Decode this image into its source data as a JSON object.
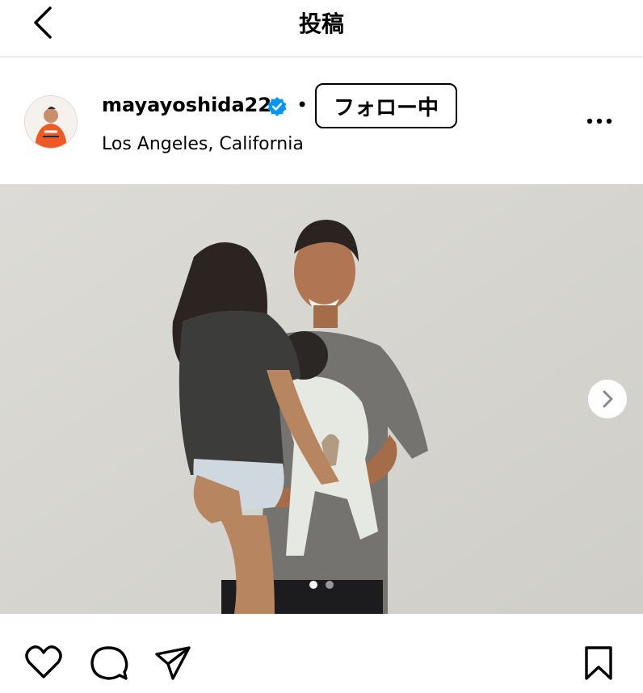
{
  "header": {
    "title": "投稿",
    "back_icon": "chevron-left-icon"
  },
  "post": {
    "username": "mayayoshida22",
    "verified_icon": "verified-badge-icon",
    "separator": "•",
    "follow_label": "フォロー中",
    "location": "Los Angeles, California",
    "more_icon": "more-horizontal-icon",
    "carousel": {
      "current": 1,
      "total": 2,
      "next_icon": "chevron-right-icon"
    },
    "accent_color": "#0095f6"
  },
  "actions": {
    "like_icon": "heart-icon",
    "comment_icon": "comment-icon",
    "share_icon": "send-icon",
    "save_icon": "bookmark-icon"
  }
}
